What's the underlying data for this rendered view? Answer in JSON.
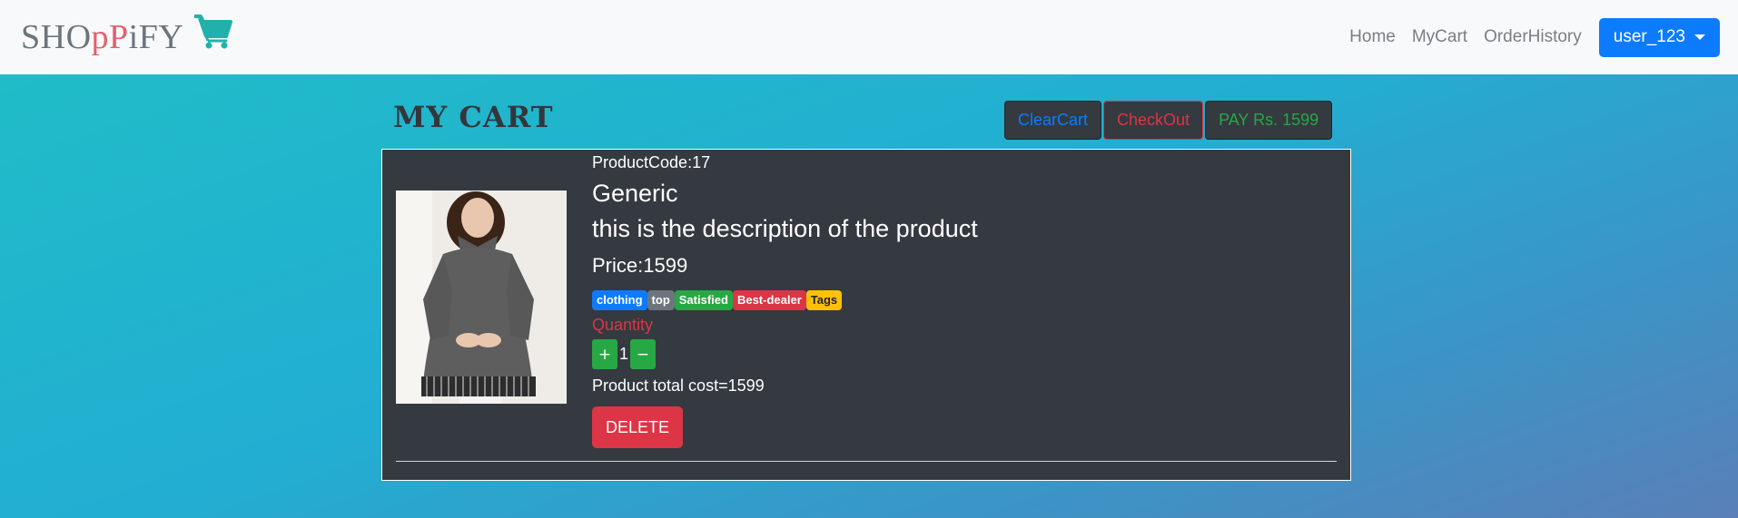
{
  "brand": {
    "part1": "SHO",
    "part2": "pP",
    "part3": "iFY",
    "cart_icon": "shopping-cart-icon",
    "cart_color": "#20b2aa"
  },
  "nav": {
    "home": "Home",
    "mycart": "MyCart",
    "orderhistory": "OrderHistory",
    "user": "user_123"
  },
  "page": {
    "title": "My Cart"
  },
  "actions": {
    "clear": "ClearCart",
    "checkout": "CheckOut",
    "pay": "PAY Rs. 1599"
  },
  "cart_item": {
    "code": "ProductCode:17",
    "name": "Generic",
    "description": "this is the description of the product",
    "price": "Price:1599",
    "tags": [
      "clothing",
      "top",
      "Satisfied",
      "Best-dealer",
      "Tags"
    ],
    "quantity_label": "Quantity",
    "plus": "+",
    "quantity": "1",
    "minus": "−",
    "total": "Product total cost=1599",
    "delete": "DELETE"
  },
  "colors": {
    "primary": "#0d7bfd",
    "danger": "#dc3545",
    "success": "#28a745",
    "warning": "#ffc107",
    "dark": "#343a40"
  }
}
